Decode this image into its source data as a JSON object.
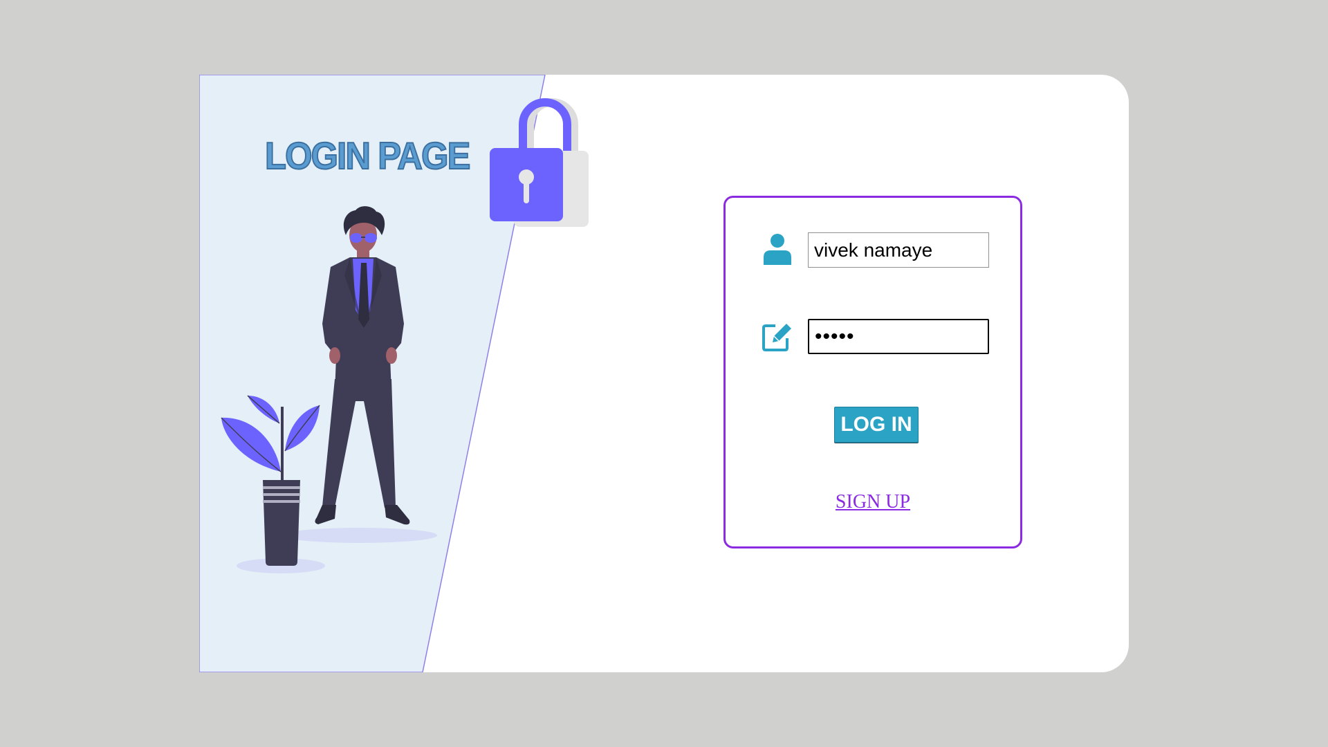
{
  "banner": {
    "title": "LOGIN PAGE"
  },
  "login_form": {
    "username_icon": "user-icon",
    "username_value": "vivek namaye",
    "password_icon": "edit-icon",
    "password_value": "•••••",
    "login_button": "LOG IN",
    "signup_link": "SIGN UP"
  },
  "colors": {
    "page_background": "#d0d0cf",
    "panel_background": "#e4eff8",
    "accent_purple": "#8a2be2",
    "illustration_purple": "#6c63ff",
    "button_teal": "#2aa3c4",
    "suit_navy": "#3f3d56"
  }
}
